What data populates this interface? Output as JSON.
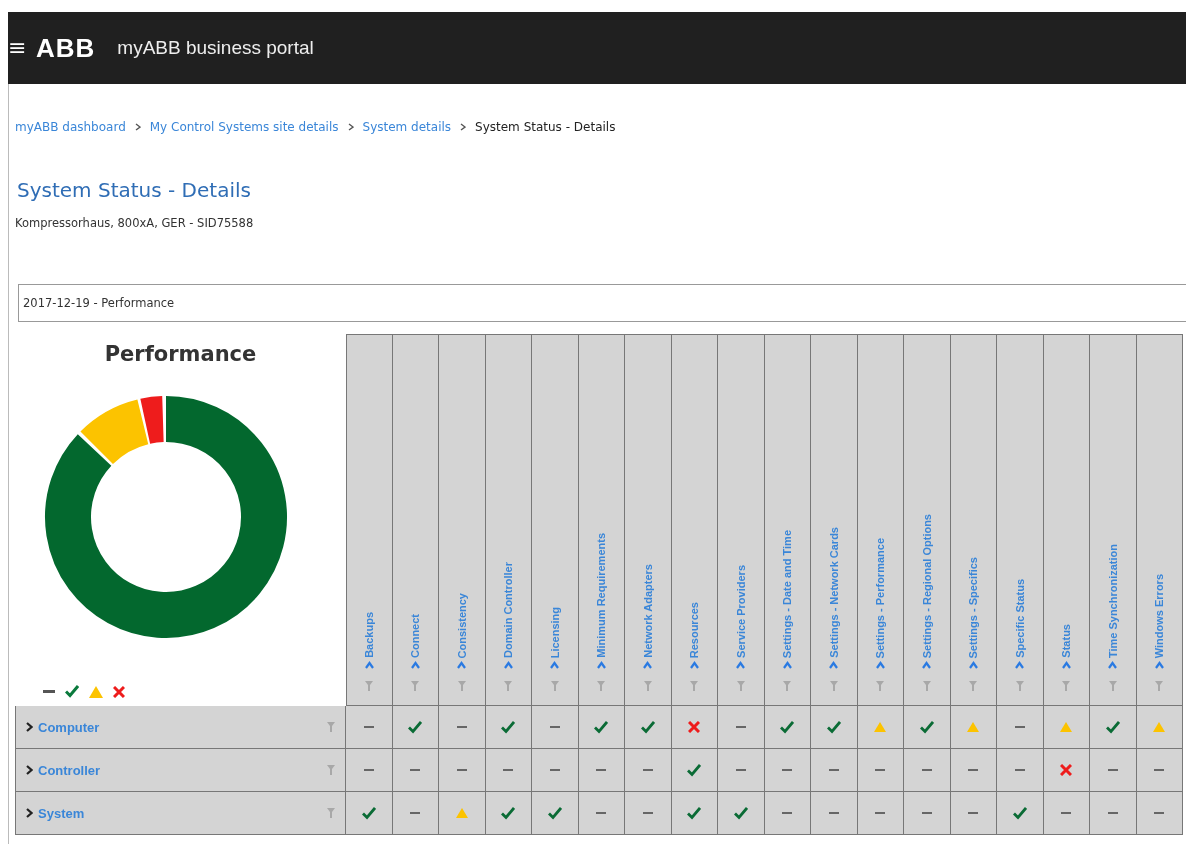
{
  "header": {
    "menu_icon": "≡",
    "logo": "ABB",
    "title": "myABB business portal"
  },
  "breadcrumb": [
    {
      "label": "myABB dashboard",
      "link": true
    },
    {
      "label": "My Control Systems site details",
      "link": true
    },
    {
      "label": "System details",
      "link": true
    },
    {
      "label": "System Status - Details",
      "link": false
    }
  ],
  "page_title": "System Status - Details",
  "subtitle": "Kompressorhaus, 800xA, GER - SID75588",
  "report_select": {
    "value": "2017-12-19 - Performance"
  },
  "chart_panel": {
    "title": "Performance",
    "legend": [
      {
        "kind": "none"
      },
      {
        "kind": "ok"
      },
      {
        "kind": "warn"
      },
      {
        "kind": "error"
      }
    ]
  },
  "table": {
    "columns": [
      "Backups",
      "Connect",
      "Consistency",
      "Domain Controller",
      "Licensing",
      "Minimum Requirements",
      "Network Adapters",
      "Resources",
      "Service Providers",
      "Settings - Date and Time",
      "Settings - Network Cards",
      "Settings - Performance",
      "Settings - Regional Options",
      "Settings - Specifics",
      "Specific Status",
      "Status",
      "Time Synchronization",
      "Windows Errors"
    ],
    "rows": [
      {
        "label": "Computer",
        "cells": [
          {
            "kind": "none"
          },
          {
            "kind": "ok"
          },
          {
            "kind": "none"
          },
          {
            "kind": "ok"
          },
          {
            "kind": "none"
          },
          {
            "kind": "ok"
          },
          {
            "kind": "ok"
          },
          {
            "kind": "error"
          },
          {
            "kind": "none"
          },
          {
            "kind": "ok"
          },
          {
            "kind": "ok"
          },
          {
            "kind": "warn"
          },
          {
            "kind": "ok"
          },
          {
            "kind": "warn"
          },
          {
            "kind": "none"
          },
          {
            "kind": "warn"
          },
          {
            "kind": "ok"
          },
          {
            "kind": "warn"
          }
        ]
      },
      {
        "label": "Controller",
        "cells": [
          {
            "kind": "none"
          },
          {
            "kind": "none"
          },
          {
            "kind": "none"
          },
          {
            "kind": "none"
          },
          {
            "kind": "none"
          },
          {
            "kind": "none"
          },
          {
            "kind": "none"
          },
          {
            "kind": "ok"
          },
          {
            "kind": "none"
          },
          {
            "kind": "none"
          },
          {
            "kind": "none"
          },
          {
            "kind": "none"
          },
          {
            "kind": "none"
          },
          {
            "kind": "none"
          },
          {
            "kind": "none"
          },
          {
            "kind": "error"
          },
          {
            "kind": "none"
          },
          {
            "kind": "none"
          }
        ]
      },
      {
        "label": "System",
        "cells": [
          {
            "kind": "ok"
          },
          {
            "kind": "none"
          },
          {
            "kind": "warn"
          },
          {
            "kind": "ok"
          },
          {
            "kind": "ok"
          },
          {
            "kind": "none"
          },
          {
            "kind": "none"
          },
          {
            "kind": "ok"
          },
          {
            "kind": "ok"
          },
          {
            "kind": "none"
          },
          {
            "kind": "none"
          },
          {
            "kind": "none"
          },
          {
            "kind": "none"
          },
          {
            "kind": "none"
          },
          {
            "kind": "ok"
          },
          {
            "kind": "none"
          },
          {
            "kind": "none"
          },
          {
            "kind": "none"
          }
        ]
      }
    ]
  }
}
